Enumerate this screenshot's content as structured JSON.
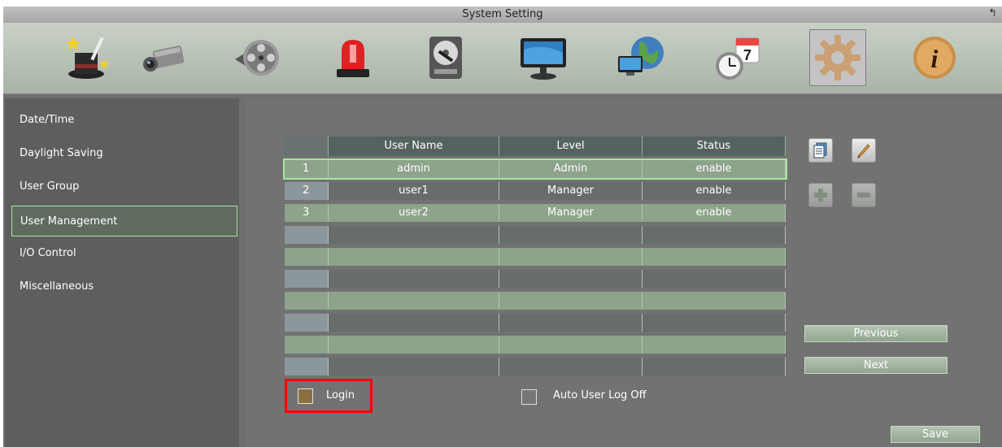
{
  "window": {
    "title": "System Setting",
    "back_glyph": "↰"
  },
  "toolbar": {
    "items": [
      {
        "name": "magic-hat-icon"
      },
      {
        "name": "camera-icon"
      },
      {
        "name": "film-reel-icon"
      },
      {
        "name": "alarm-light-icon"
      },
      {
        "name": "hard-drive-icon"
      },
      {
        "name": "monitor-icon"
      },
      {
        "name": "network-globe-icon"
      },
      {
        "name": "clock-calendar-icon",
        "calendar_text": "7"
      },
      {
        "name": "gear-icon",
        "active": true
      },
      {
        "name": "info-icon",
        "glyph": "i"
      }
    ]
  },
  "sidebar": {
    "items": [
      {
        "label": "Date/Time"
      },
      {
        "label": "Daylight Saving"
      },
      {
        "label": "User Group"
      },
      {
        "label": "User Management",
        "selected": true
      },
      {
        "label": "I/O Control"
      },
      {
        "label": "Miscellaneous"
      }
    ]
  },
  "table": {
    "headers": [
      "",
      "User Name",
      "Level",
      "Status"
    ],
    "rows": [
      {
        "num": "1",
        "user": "admin",
        "level": "Admin",
        "status": "enable",
        "selected": true
      },
      {
        "num": "2",
        "user": "user1",
        "level": "Manager",
        "status": "enable"
      },
      {
        "num": "3",
        "user": "user2",
        "level": "Manager",
        "status": "enable"
      },
      {
        "num": "",
        "user": "",
        "level": "",
        "status": ""
      },
      {
        "num": "",
        "user": "",
        "level": "",
        "status": ""
      },
      {
        "num": "",
        "user": "",
        "level": "",
        "status": ""
      },
      {
        "num": "",
        "user": "",
        "level": "",
        "status": ""
      },
      {
        "num": "",
        "user": "",
        "level": "",
        "status": ""
      },
      {
        "num": "",
        "user": "",
        "level": "",
        "status": ""
      },
      {
        "num": "",
        "user": "",
        "level": "",
        "status": ""
      }
    ]
  },
  "actions": {
    "copy": "copy-icon",
    "edit": "pencil-icon",
    "add": "plus-icon",
    "remove": "minus-icon",
    "previous": "Previous",
    "next": "Next",
    "save": "Save"
  },
  "options": {
    "login_label": "Login",
    "login_checked": false,
    "auto_logoff_label": "Auto User Log Off",
    "auto_logoff_checked": false
  },
  "colors": {
    "highlight_border": "#ff0000",
    "selection_border": "#a8e6a0",
    "row_green": "#8da38a",
    "row_gray": "#676d6c"
  }
}
